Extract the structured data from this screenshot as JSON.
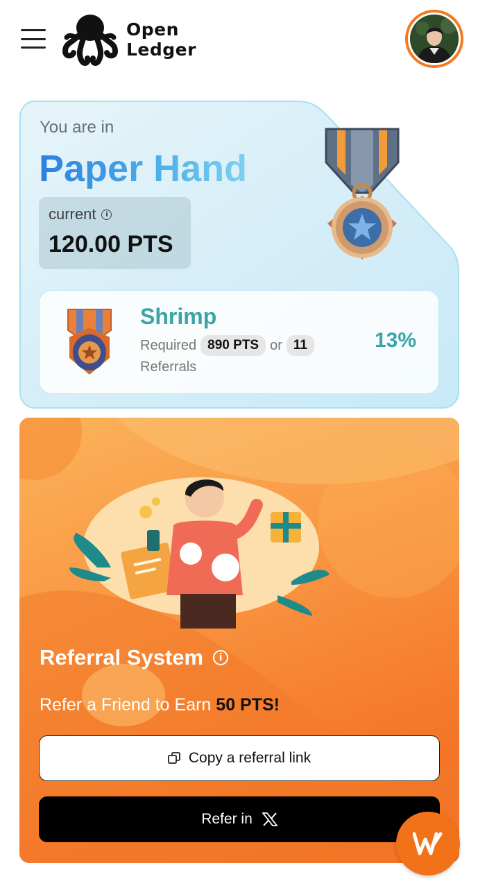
{
  "header": {
    "logo_line1": "Open",
    "logo_line2": "Ledger",
    "menu_icon": "hamburger-icon",
    "avatar_icon": "user-avatar"
  },
  "rank": {
    "intro": "You are in",
    "name": "Paper Hand",
    "current_label": "current",
    "current_value": "120.00 PTS",
    "medal_icon": "medal-star-icon"
  },
  "next_tier": {
    "name": "Shrimp",
    "required_label": "Required",
    "required_pts": "890 PTS",
    "or_label": "or",
    "required_referrals": "11",
    "referrals_label": "Referrals",
    "progress": "13%"
  },
  "referral": {
    "title": "Referral System",
    "subtitle_prefix": "Refer a Friend to Earn",
    "subtitle_reward": "50 PTS!",
    "copy_button": "Copy a referral link",
    "refer_button": "Refer in",
    "refer_icon": "x-logo-icon"
  },
  "colors": {
    "accent_orange": "#f47920",
    "tier_teal": "#3aa4a7",
    "rank_blue": "#2f7ee0"
  }
}
